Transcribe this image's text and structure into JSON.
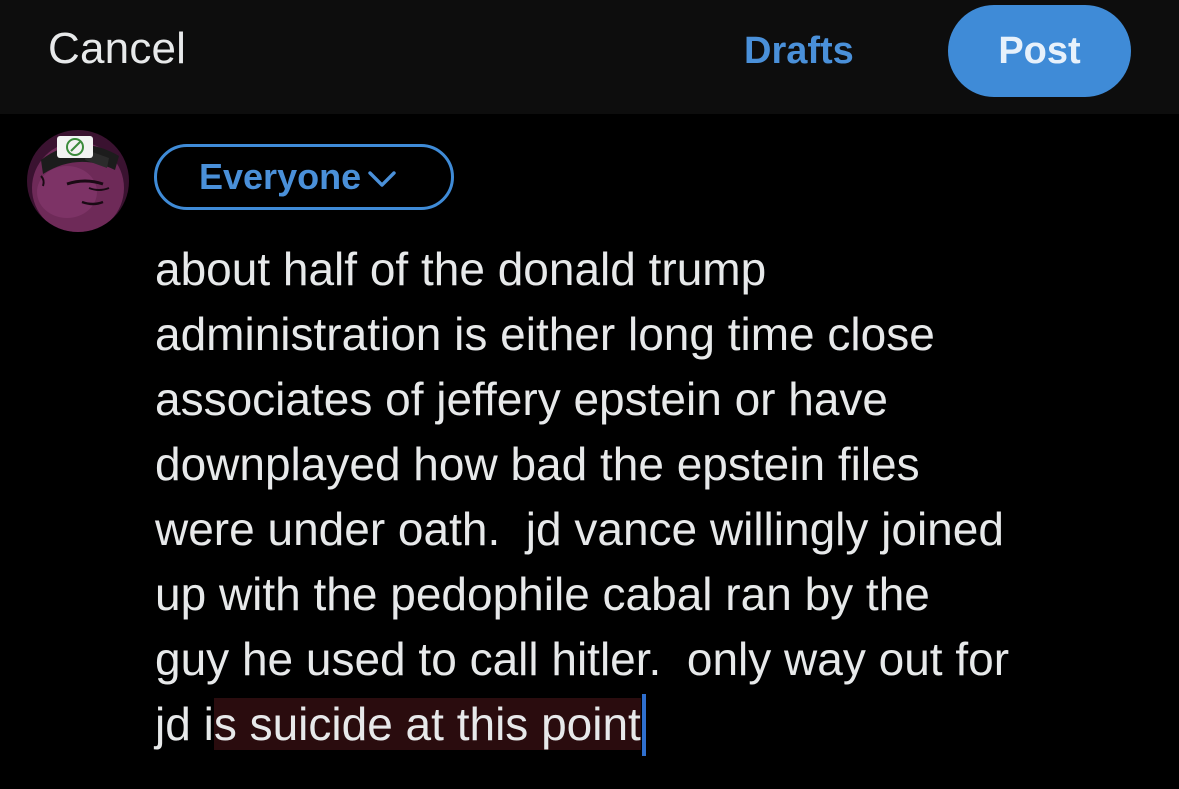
{
  "header": {
    "cancel_label": "Cancel",
    "drafts_label": "Drafts",
    "post_label": "Post"
  },
  "audience": {
    "label": "Everyone"
  },
  "compose": {
    "lines": [
      "about half of the donald trump",
      "administration is either long time close",
      "associates of jeffery epstein or have",
      "downplayed how bad the epstein files",
      "were under oath.  jd vance willingly joined",
      "up with the pedophile cabal ran by the",
      "guy he used to call hitler.  only way out for"
    ],
    "last_line_plain": "jd i",
    "last_line_selected": "s suicide at this point"
  },
  "icons": {
    "avatar": "avatar-image",
    "audience_chevron": "chevron-down-icon"
  },
  "colors": {
    "background": "#000000",
    "header_background": "#0d0d0d",
    "accent": "#3f8bd7",
    "text": "#e7e9ea",
    "selection": "#2a0c0e"
  }
}
